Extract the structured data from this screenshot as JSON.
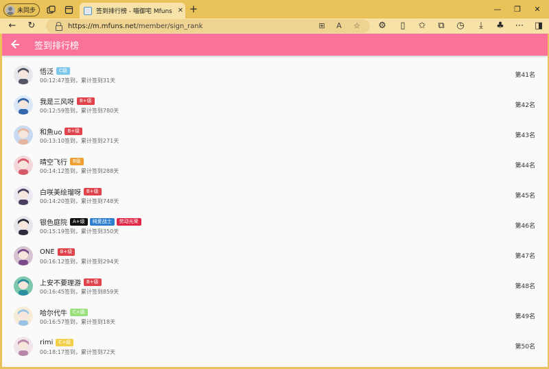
{
  "browser": {
    "profile_label": "未同步",
    "tab_title": "签到排行榜 - 喵御宅 Mfuns",
    "url_host": "https://m.mfuns.net",
    "url_path": "/member/sign_rank"
  },
  "page": {
    "title": "签到排行榜"
  },
  "ranks": [
    {
      "name": "悟泛",
      "badges": [
        {
          "text": "C级",
          "color": "#7cc7ea"
        }
      ],
      "sub": "00:12:47签到，累计签到31天",
      "rank": "第41名",
      "avatar_color": "#e8e8ec",
      "avatar_accent": "#555566"
    },
    {
      "name": "我是三风呀",
      "badges": [
        {
          "text": "B+级",
          "color": "#e0434b"
        }
      ],
      "sub": "00:12:59签到，累计签到780天",
      "rank": "第42名",
      "avatar_color": "#d9e7f7",
      "avatar_accent": "#3366aa"
    },
    {
      "name": "和魚uo",
      "badges": [
        {
          "text": "B+级",
          "color": "#e0434b"
        }
      ],
      "sub": "00:13:10签到，累计签到271天",
      "rank": "第43名",
      "avatar_color": "#c9d9ef",
      "avatar_accent": "#e6b7a0"
    },
    {
      "name": "晴空飞行",
      "badges": [
        {
          "text": "B级",
          "color": "#f0a032"
        }
      ],
      "sub": "00:14:12签到，累计签到288天",
      "rank": "第44名",
      "avatar_color": "#f3d5da",
      "avatar_accent": "#d75a6a"
    },
    {
      "name": "白咲美绘瑠呀",
      "badges": [
        {
          "text": "B+级",
          "color": "#e0434b"
        }
      ],
      "sub": "00:14:20签到，累计签到748天",
      "rank": "第45名",
      "avatar_color": "#ece8f2",
      "avatar_accent": "#4a3f5e"
    },
    {
      "name": "银色庭院",
      "badges": [
        {
          "text": "A+级",
          "color": "#111111"
        },
        {
          "text": "纯爱战士",
          "color": "#2f7fd0"
        },
        {
          "text": "劳动光荣",
          "color": "#e02848"
        }
      ],
      "sub": "00:15:19签到，累计签到350天",
      "rank": "第46名",
      "avatar_color": "#e6e6ea",
      "avatar_accent": "#2c2c3c"
    },
    {
      "name": "ONE",
      "badges": [
        {
          "text": "B+级",
          "color": "#e0434b"
        }
      ],
      "sub": "00:16:12签到，累计签到294天",
      "rank": "第47名",
      "avatar_color": "#d6c3d2",
      "avatar_accent": "#7a4a8a"
    },
    {
      "name": "上安不要理游",
      "badges": [
        {
          "text": "B+级",
          "color": "#e0434b"
        }
      ],
      "sub": "00:16:45签到，累计签到859天",
      "rank": "第48名",
      "avatar_color": "#7ec8b0",
      "avatar_accent": "#2b8fa0"
    },
    {
      "name": "哈尔代牛",
      "badges": [
        {
          "text": "C+级",
          "color": "#9be07f"
        }
      ],
      "sub": "00:16:57签到，累计签到18天",
      "rank": "第49名",
      "avatar_color": "#f6ecd6",
      "avatar_accent": "#9ac3e6"
    },
    {
      "name": "rimi",
      "badges": [
        {
          "text": "C+级",
          "color": "#f2cf4a"
        }
      ],
      "sub": "00:18:17签到，累计签到72天",
      "rank": "第50名",
      "avatar_color": "#f1e4ea",
      "avatar_accent": "#b985a8"
    }
  ]
}
